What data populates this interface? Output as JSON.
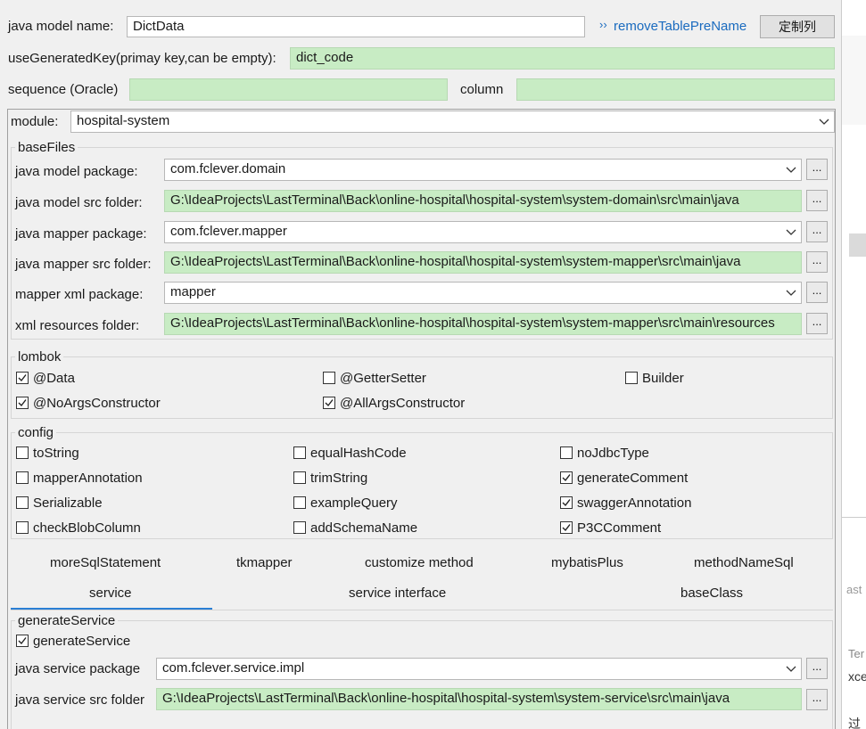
{
  "top": {
    "model_name_label": "java model name:",
    "model_name_value": "DictData",
    "remove_prefix_label": "removeTablePreName",
    "customize_columns_label": "定制列",
    "generated_key_label": "useGeneratedKey(primay key,can be empty):",
    "generated_key_value": "dict_code",
    "sequence_label": "sequence (Oracle)",
    "sequence_value": "",
    "column_label": "column",
    "column_value": ""
  },
  "module": {
    "label": "module:",
    "value": "hospital-system"
  },
  "baseFiles": {
    "title": "baseFiles",
    "rows": [
      {
        "label": "java model package:",
        "value": "com.fclever.domain",
        "type": "combo"
      },
      {
        "label": "java model src folder:",
        "value": "G:\\IdeaProjects\\LastTerminal\\Back\\online-hospital\\hospital-system\\system-domain\\src\\main\\java",
        "type": "path"
      },
      {
        "label": "java mapper package:",
        "value": "com.fclever.mapper",
        "type": "combo"
      },
      {
        "label": "java mapper src folder:",
        "value": "G:\\IdeaProjects\\LastTerminal\\Back\\online-hospital\\hospital-system\\system-mapper\\src\\main\\java",
        "type": "path"
      },
      {
        "label": "mapper xml package:",
        "value": "mapper",
        "type": "combo"
      },
      {
        "label": "xml resources folder:",
        "value": "G:\\IdeaProjects\\LastTerminal\\Back\\online-hospital\\hospital-system\\system-mapper\\src\\main\\resources",
        "type": "path"
      }
    ],
    "browse_label": "..."
  },
  "lombok": {
    "title": "lombok",
    "items": [
      {
        "label": "@Data",
        "checked": true
      },
      {
        "label": "@GetterSetter",
        "checked": false
      },
      {
        "label": "Builder",
        "checked": false
      },
      {
        "label": "@NoArgsConstructor",
        "checked": true
      },
      {
        "label": "@AllArgsConstructor",
        "checked": true
      }
    ]
  },
  "config": {
    "title": "config",
    "items": [
      {
        "label": "toString",
        "checked": false
      },
      {
        "label": "equalHashCode",
        "checked": false
      },
      {
        "label": "noJdbcType",
        "checked": false
      },
      {
        "label": "mapperAnnotation",
        "checked": false
      },
      {
        "label": "trimString",
        "checked": false
      },
      {
        "label": "generateComment",
        "checked": true
      },
      {
        "label": "Serializable",
        "checked": false
      },
      {
        "label": "exampleQuery",
        "checked": false
      },
      {
        "label": "swaggerAnnotation",
        "checked": true
      },
      {
        "label": "checkBlobColumn",
        "checked": false
      },
      {
        "label": "addSchemaName",
        "checked": false
      },
      {
        "label": "P3CComment",
        "checked": true
      }
    ]
  },
  "tabs": {
    "row1": [
      "moreSqlStatement",
      "tkmapper",
      "customize method",
      "mybatisPlus",
      "methodNameSql"
    ],
    "row2": [
      "service",
      "service interface",
      "baseClass"
    ],
    "active": "service"
  },
  "generateService": {
    "title": "generateService",
    "checkbox_label": "generateService",
    "checked": true,
    "package_label": "java service package",
    "package_value": "com.fclever.service.impl",
    "folder_label": "java service src folder",
    "folder_value": "G:\\IdeaProjects\\LastTerminal\\Back\\online-hospital\\hospital-system\\system-service\\src\\main\\java"
  },
  "right_edge_fragments": [
    "ast",
    "Ter",
    "xce",
    "过不"
  ],
  "colors": {
    "green_field": "#c8ecc4",
    "link_blue": "#1a6bbf",
    "active_tab_underline": "#2a7fd4"
  }
}
